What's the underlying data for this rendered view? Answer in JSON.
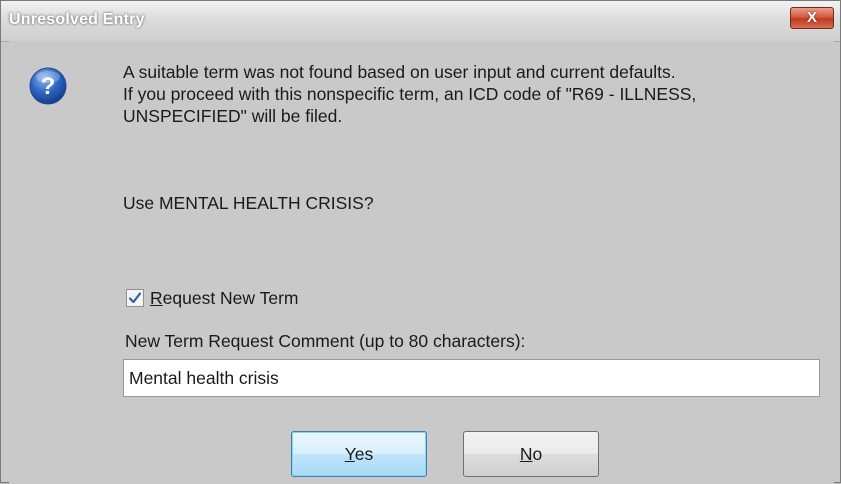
{
  "window": {
    "title": "Unresolved Entry",
    "close_label": "X"
  },
  "message": {
    "line1": "A suitable term was not found based on user input and current defaults.",
    "line2": "If you proceed with this nonspecific term, an ICD code of \"R69 - ILLNESS,",
    "line3": "UNSPECIFIED\" will be filed.",
    "question": "Use  MENTAL HEALTH CRISIS?"
  },
  "request_new_term": {
    "checked": true,
    "label_access_key": "R",
    "label_rest": "equest New Term"
  },
  "comment": {
    "label": "New Term Request Comment (up to 80 characters):",
    "value": "Mental health crisis"
  },
  "buttons": {
    "yes_access_key": "Y",
    "yes_rest": "es",
    "no_access_key": "N",
    "no_rest": "o"
  },
  "icons": {
    "dialog_icon": "question-icon",
    "checkbox_mark": "checkmark-icon"
  },
  "colors": {
    "accent": "#2a5fb5",
    "close_button": "#c8452a"
  }
}
